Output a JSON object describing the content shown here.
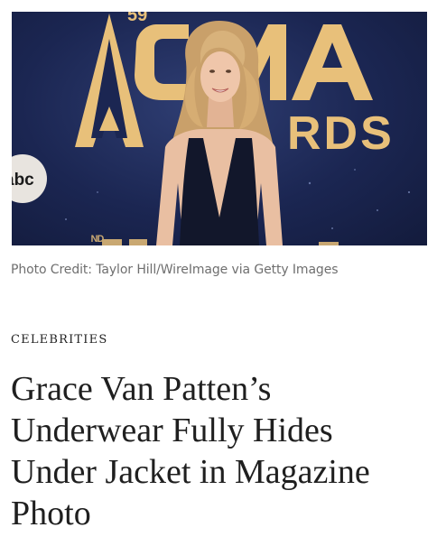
{
  "hero_image": {
    "alt": "Grace Van Patten at the CMA Awards",
    "backdrop_text": "CMA AWARDS",
    "event_number": "59",
    "network_badge": "abc"
  },
  "photo_credit": "Photo Credit: Taylor Hill/WireImage via Getty Images",
  "category": "CELEBRITIES",
  "headline": "Grace Van Patten’s Underwear Fully Hides Under Jacket in Magazine Photo",
  "colors": {
    "backdrop": "#1b2652",
    "gold": "#e8c07a",
    "credit_text": "#6f6f6f",
    "headline_text": "#1f1f1f"
  }
}
